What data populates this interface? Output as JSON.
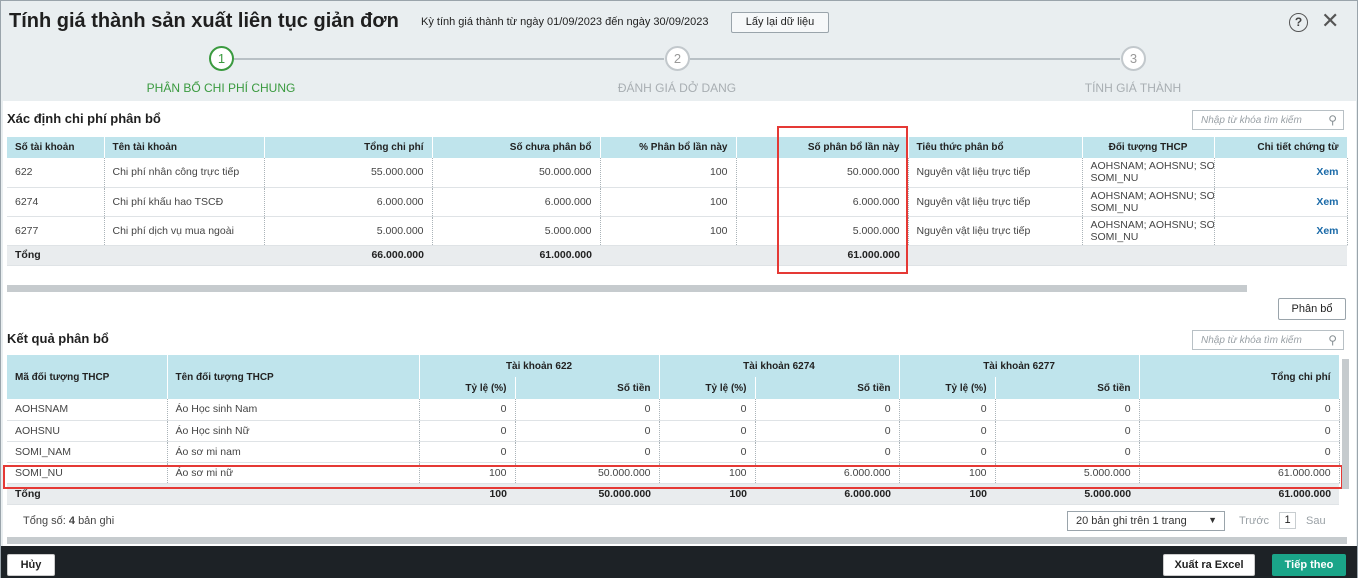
{
  "header": {
    "title": "Tính giá thành sản xuất liên tục giản đơn",
    "period": "Kỳ tính giá thành từ ngày 01/09/2023 đến ngày 30/09/2023",
    "reload_label": "Lấy lại dữ liệu",
    "help_glyph": "?",
    "close_glyph": "✕"
  },
  "steps": [
    {
      "number": "1",
      "label": "PHÂN BỔ CHI PHÍ CHUNG",
      "active": true
    },
    {
      "number": "2",
      "label": "ĐÁNH GIÁ DỞ DANG",
      "active": false
    },
    {
      "number": "3",
      "label": "TÍNH GIÁ THÀNH",
      "active": false
    }
  ],
  "section1": {
    "title": "Xác định chi phí phân bổ",
    "search_placeholder": "Nhập từ khóa tìm kiếm",
    "columns": [
      "Số tài khoản",
      "Tên tài khoản",
      "Tổng chi phí",
      "Số chưa phân bổ",
      "% Phân bổ lần này",
      "Số phân bổ lần này",
      "Tiêu thức phân bổ",
      "Đối tượng THCP",
      "Chi tiết chứng từ"
    ],
    "rows": [
      {
        "account": "622",
        "name": "Chi phí nhân công trực tiếp",
        "total": "55.000.000",
        "unallocated": "50.000.000",
        "percent": "100",
        "allocated": "50.000.000",
        "criteria": "Nguyên vật liệu trực tiếp",
        "objects": "AOHSNAM; AOHSNU; SOI",
        "objects2": "SOMI_NU",
        "detail": "Xem"
      },
      {
        "account": "6274",
        "name": "Chi phí khấu hao TSCĐ",
        "total": "6.000.000",
        "unallocated": "6.000.000",
        "percent": "100",
        "allocated": "6.000.000",
        "criteria": "Nguyên vật liệu trực tiếp",
        "objects": "AOHSNAM; AOHSNU; SOI",
        "objects2": "SOMI_NU",
        "detail": "Xem"
      },
      {
        "account": "6277",
        "name": "Chi phí dịch vụ mua ngoài",
        "total": "5.000.000",
        "unallocated": "5.000.000",
        "percent": "100",
        "allocated": "5.000.000",
        "criteria": "Nguyên vật liệu trực tiếp",
        "objects": "AOHSNAM; AOHSNU; SOI",
        "objects2": "SOMI_NU",
        "detail": "Xem"
      }
    ],
    "totals": {
      "label": "Tổng",
      "total": "66.000.000",
      "unallocated": "61.000.000",
      "allocated": "61.000.000"
    },
    "allocate_button": "Phân bổ"
  },
  "section2": {
    "title": "Kết quả phân bổ",
    "search_placeholder": "Nhập từ khóa tìm kiếm",
    "col_code": "Mã đối tượng THCP",
    "col_name": "Tên đối tượng THCP",
    "groups": [
      "Tài khoản 622",
      "Tài khoản 6274",
      "Tài khoản 6277"
    ],
    "sub_rate": "Tỷ lệ (%)",
    "sub_amount": "Số tiền",
    "col_total": "Tổng chi phí",
    "rows": [
      {
        "code": "AOHSNAM",
        "name": "Áo Học sinh Nam",
        "r1": "0",
        "a1": "0",
        "r2": "0",
        "a2": "0",
        "r3": "0",
        "a3": "0",
        "total": "0"
      },
      {
        "code": "AOHSNU",
        "name": "Áo Học sinh Nữ",
        "r1": "0",
        "a1": "0",
        "r2": "0",
        "a2": "0",
        "r3": "0",
        "a3": "0",
        "total": "0"
      },
      {
        "code": "SOMI_NAM",
        "name": "Áo sơ mi nam",
        "r1": "0",
        "a1": "0",
        "r2": "0",
        "a2": "0",
        "r3": "0",
        "a3": "0",
        "total": "0"
      },
      {
        "code": "SOMI_NU",
        "name": "Áo sơ mi nữ",
        "r1": "100",
        "a1": "50.000.000",
        "r2": "100",
        "a2": "6.000.000",
        "r3": "100",
        "a3": "5.000.000",
        "total": "61.000.000"
      }
    ],
    "totals": {
      "label": "Tổng",
      "r1": "100",
      "a1": "50.000.000",
      "r2": "100",
      "a2": "6.000.000",
      "r3": "100",
      "a3": "5.000.000",
      "total": "61.000.000"
    },
    "record_count_label": "Tổng số:",
    "record_count": "4",
    "record_count_suffix": "bản ghi",
    "page_size": "20 bản ghi trên 1 trang",
    "prev": "Trước",
    "page": "1",
    "next": "Sau"
  },
  "footer": {
    "cancel": "Hủy",
    "export": "Xuất ra Excel",
    "next": "Tiếp theo"
  },
  "colors": {
    "accent_green": "#3a9a3f",
    "header_blue": "#bfe4ec",
    "primary_button": "#1aa589",
    "highlight": "#e53935"
  }
}
